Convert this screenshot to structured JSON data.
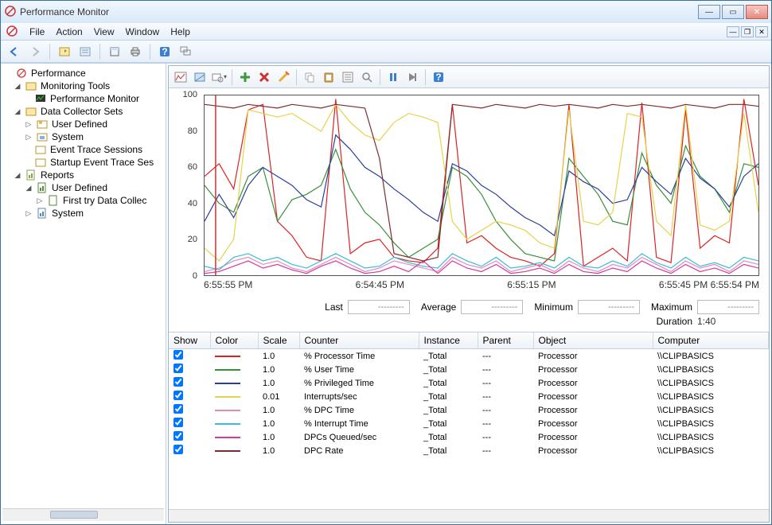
{
  "window": {
    "title": "Performance Monitor"
  },
  "menu": {
    "file": "File",
    "action": "Action",
    "view": "View",
    "window": "Window",
    "help": "Help"
  },
  "tree": {
    "root": "Performance",
    "monitoring_tools": "Monitoring Tools",
    "performance_monitor": "Performance Monitor",
    "data_collector_sets": "Data Collector Sets",
    "user_defined": "User Defined",
    "system": "System",
    "event_trace_sessions": "Event Trace Sessions",
    "startup_event_trace": "Startup Event Trace Ses",
    "reports": "Reports",
    "reports_user_defined": "User Defined",
    "first_try": "First try  Data Collec",
    "reports_system": "System"
  },
  "chart_data": {
    "type": "line",
    "ylim": [
      0,
      100
    ],
    "yticks": [
      0,
      20,
      40,
      60,
      80,
      100
    ],
    "xlabels": [
      "6:55:55 PM",
      "6:54:45 PM",
      "6:55:15 PM",
      "6:55:45 PM 6:55:54 PM"
    ],
    "series": [
      {
        "name": "% Processor Time",
        "color": "#d22",
        "values": [
          55,
          62,
          48,
          92,
          95,
          30,
          22,
          10,
          8,
          98,
          12,
          18,
          20,
          10,
          8,
          7,
          15,
          95,
          18,
          22,
          15,
          10,
          8,
          5,
          12,
          95,
          5,
          10,
          15,
          8,
          96,
          10,
          7,
          92,
          15,
          22,
          18,
          98,
          50
        ]
      },
      {
        "name": "% User Time",
        "color": "#3a8f3a",
        "values": [
          50,
          40,
          35,
          55,
          60,
          30,
          42,
          45,
          50,
          70,
          48,
          35,
          28,
          18,
          10,
          15,
          20,
          60,
          55,
          45,
          30,
          20,
          12,
          10,
          8,
          65,
          55,
          45,
          30,
          28,
          68,
          50,
          40,
          72,
          55,
          48,
          35,
          62,
          60
        ]
      },
      {
        "name": "% Privileged Time",
        "color": "#2a3ea0",
        "values": [
          30,
          45,
          32,
          50,
          60,
          55,
          50,
          42,
          38,
          78,
          70,
          60,
          55,
          48,
          42,
          35,
          30,
          62,
          58,
          50,
          45,
          38,
          32,
          28,
          22,
          58,
          52,
          48,
          40,
          42,
          60,
          52,
          45,
          65,
          54,
          48,
          38,
          55,
          62
        ]
      },
      {
        "name": "Interrupts/sec",
        "color": "#e6d34a",
        "values": [
          15,
          8,
          20,
          92,
          90,
          88,
          90,
          85,
          80,
          95,
          85,
          78,
          75,
          85,
          90,
          88,
          85,
          30,
          20,
          25,
          30,
          28,
          25,
          18,
          15,
          92,
          30,
          28,
          35,
          90,
          88,
          30,
          22,
          95,
          28,
          25,
          30,
          90,
          35
        ]
      },
      {
        "name": "% DPC Time",
        "color": "#e28ac2",
        "values": [
          2,
          4,
          8,
          10,
          6,
          8,
          4,
          2,
          6,
          10,
          6,
          2,
          4,
          8,
          6,
          4,
          2,
          10,
          6,
          4,
          8,
          2,
          4,
          6,
          2,
          8,
          4,
          2,
          6,
          4,
          10,
          6,
          2,
          8,
          4,
          6,
          2,
          8,
          6
        ]
      },
      {
        "name": "% Interrupt Time",
        "color": "#3bbbd6",
        "values": [
          5,
          3,
          10,
          12,
          8,
          10,
          6,
          4,
          8,
          12,
          8,
          4,
          5,
          10,
          7,
          5,
          4,
          12,
          8,
          5,
          10,
          4,
          5,
          7,
          4,
          10,
          5,
          4,
          8,
          5,
          12,
          7,
          4,
          10,
          5,
          7,
          4,
          10,
          8
        ]
      },
      {
        "name": "DPCs Queued/sec",
        "color": "#d63aa0",
        "values": [
          1,
          2,
          5,
          8,
          4,
          6,
          3,
          1,
          5,
          8,
          4,
          1,
          2,
          5,
          2,
          8,
          1,
          8,
          4,
          2,
          6,
          1,
          2,
          4,
          1,
          6,
          2,
          1,
          4,
          2,
          8,
          4,
          1,
          6,
          2,
          4,
          1,
          6,
          4
        ]
      },
      {
        "name": "DPC Rate",
        "color": "#7d2b2b",
        "values": [
          95,
          94,
          93,
          95,
          94,
          93,
          95,
          94,
          93,
          95,
          94,
          93,
          65,
          12,
          10,
          8,
          10,
          95,
          94,
          93,
          95,
          94,
          93,
          95,
          94,
          95,
          94,
          93,
          95,
          94,
          95,
          94,
          93,
          95,
          94,
          93,
          95,
          95,
          94
        ]
      }
    ]
  },
  "stats": {
    "last_label": "Last",
    "last_val": "---------",
    "avg_label": "Average",
    "avg_val": "---------",
    "min_label": "Minimum",
    "min_val": "---------",
    "max_label": "Maximum",
    "max_val": "---------",
    "dur_label": "Duration",
    "dur_val": "1:40"
  },
  "table": {
    "headers": {
      "show": "Show",
      "color": "Color",
      "scale": "Scale",
      "counter": "Counter",
      "instance": "Instance",
      "parent": "Parent",
      "object": "Object",
      "computer": "Computer"
    },
    "rows": [
      {
        "color": "#d22",
        "scale": "1.0",
        "counter": "% Processor Time",
        "instance": "_Total",
        "parent": "---",
        "object": "Processor",
        "computer": "\\\\CLIPBASICS"
      },
      {
        "color": "#3a8f3a",
        "scale": "1.0",
        "counter": "% User Time",
        "instance": "_Total",
        "parent": "---",
        "object": "Processor",
        "computer": "\\\\CLIPBASICS"
      },
      {
        "color": "#2a3ea0",
        "scale": "1.0",
        "counter": "% Privileged Time",
        "instance": "_Total",
        "parent": "---",
        "object": "Processor",
        "computer": "\\\\CLIPBASICS"
      },
      {
        "color": "#e6d34a",
        "scale": "0.01",
        "counter": "Interrupts/sec",
        "instance": "_Total",
        "parent": "---",
        "object": "Processor",
        "computer": "\\\\CLIPBASICS"
      },
      {
        "color": "#e28ac2",
        "scale": "1.0",
        "counter": "% DPC Time",
        "instance": "_Total",
        "parent": "---",
        "object": "Processor",
        "computer": "\\\\CLIPBASICS"
      },
      {
        "color": "#3bbbd6",
        "scale": "1.0",
        "counter": "% Interrupt Time",
        "instance": "_Total",
        "parent": "---",
        "object": "Processor",
        "computer": "\\\\CLIPBASICS"
      },
      {
        "color": "#d63aa0",
        "scale": "1.0",
        "counter": "DPCs Queued/sec",
        "instance": "_Total",
        "parent": "---",
        "object": "Processor",
        "computer": "\\\\CLIPBASICS"
      },
      {
        "color": "#7d2b2b",
        "scale": "1.0",
        "counter": "DPC Rate",
        "instance": "_Total",
        "parent": "---",
        "object": "Processor",
        "computer": "\\\\CLIPBASICS"
      }
    ]
  }
}
